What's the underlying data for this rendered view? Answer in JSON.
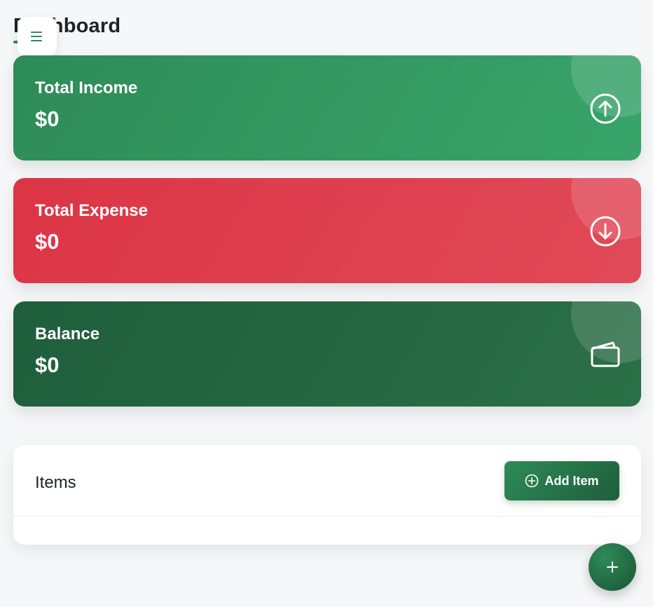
{
  "header": {
    "title": "Dashboard",
    "menu_icon": "hamburger-menu-icon"
  },
  "cards": [
    {
      "label": "Total Income",
      "value": "$0",
      "icon": "arrow-up-circle-icon",
      "color": "#2e8b57"
    },
    {
      "label": "Total Expense",
      "value": "$0",
      "icon": "arrow-down-circle-icon",
      "color": "#dc3545"
    },
    {
      "label": "Balance",
      "value": "$0",
      "icon": "wallet-icon",
      "color": "#1f5e3c"
    }
  ],
  "items": {
    "title": "Items",
    "add_button_label": "Add Item",
    "add_button_icon": "plus-circle-icon"
  },
  "fab": {
    "icon": "plus-icon"
  },
  "colors": {
    "accent": "#2e8b57",
    "background": "#f6f7f9",
    "expense": "#dc3545",
    "balance": "#1f5e3c"
  }
}
